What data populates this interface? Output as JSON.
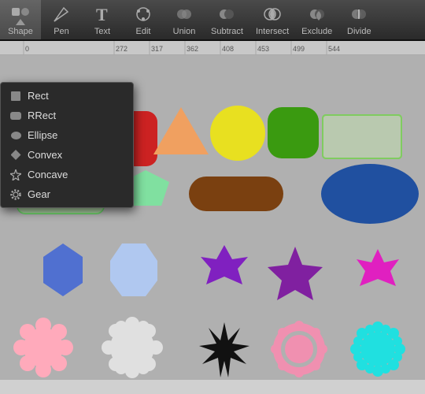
{
  "toolbar": {
    "items": [
      {
        "label": "Shape",
        "active": true
      },
      {
        "label": "Pen"
      },
      {
        "label": "Text"
      },
      {
        "label": "Edit"
      },
      {
        "label": "Union"
      },
      {
        "label": "Subtract"
      },
      {
        "label": "Intersect"
      },
      {
        "label": "Exclude"
      },
      {
        "label": "Divide"
      }
    ]
  },
  "dropdown": {
    "items": [
      {
        "label": "Rect",
        "icon": "rect"
      },
      {
        "label": "RRect",
        "icon": "rrect"
      },
      {
        "label": "Ellipse",
        "icon": "ellipse"
      },
      {
        "label": "Convex",
        "icon": "convex"
      },
      {
        "label": "Concave",
        "icon": "concave"
      },
      {
        "label": "Gear",
        "icon": "gear"
      }
    ]
  },
  "ruler": {
    "marks": [
      "0",
      "272",
      "317",
      "362",
      "408",
      "453",
      "499",
      "544"
    ]
  }
}
